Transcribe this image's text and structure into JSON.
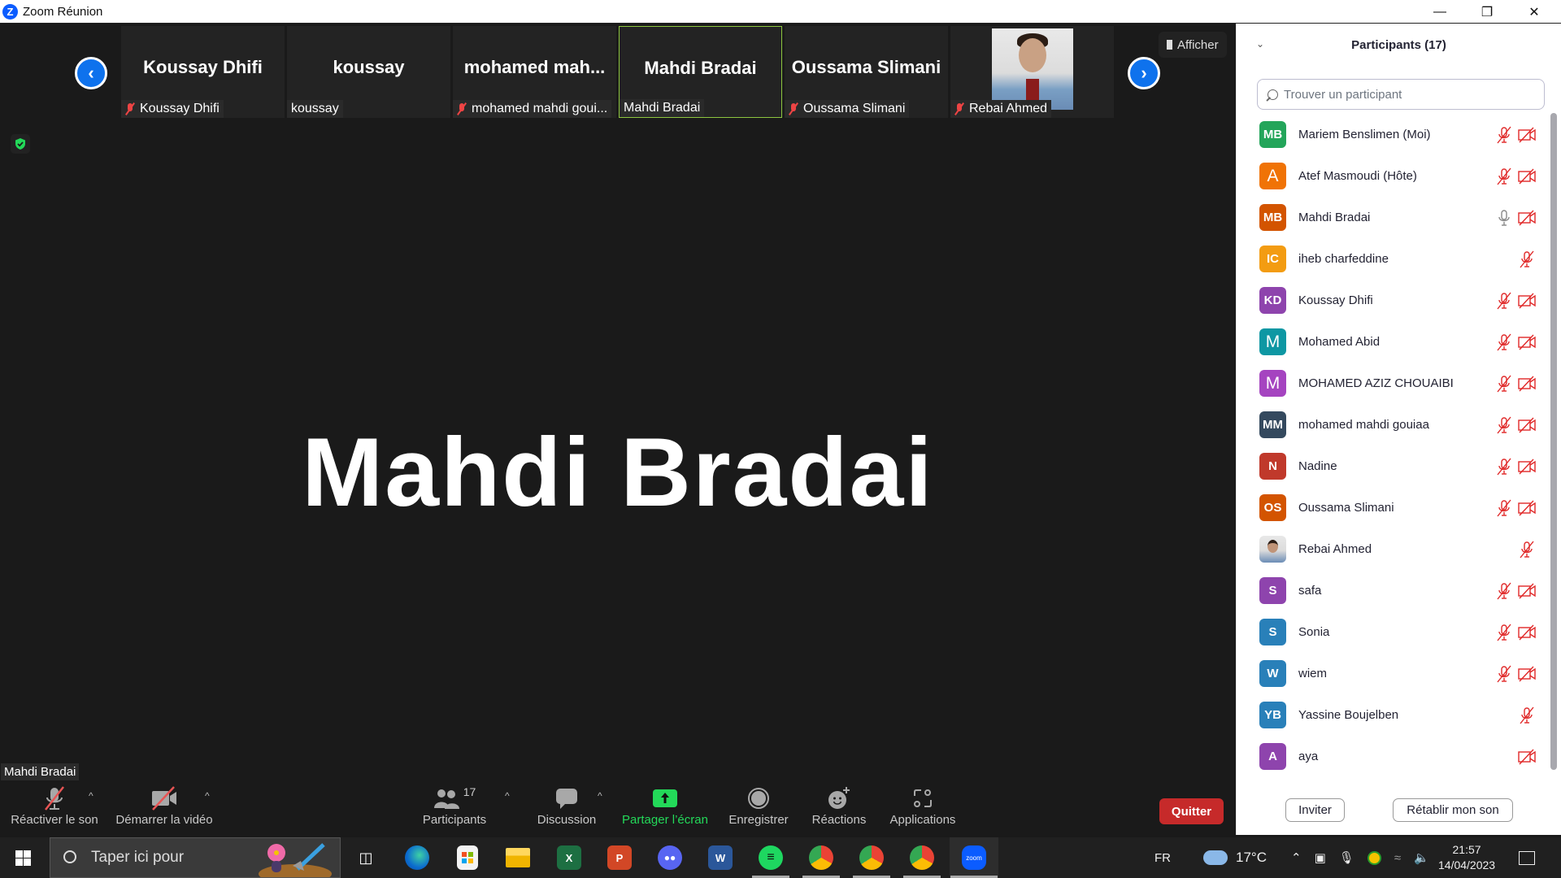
{
  "window": {
    "title": "Zoom Réunion",
    "controls": {
      "minimize": "—",
      "restore": "❐",
      "close": "✕"
    }
  },
  "strip": {
    "thumbnails": [
      {
        "display_name": "Koussay Dhifi",
        "label": "Koussay Dhifi",
        "muted": true,
        "active": false
      },
      {
        "display_name": "koussay",
        "label": "koussay",
        "muted": false,
        "active": false
      },
      {
        "display_name": "mohamed  mah...",
        "label": "mohamed mahdi goui...",
        "muted": true,
        "active": false
      },
      {
        "display_name": "Mahdi Bradai",
        "label": "Mahdi Bradai",
        "muted": false,
        "active": true
      },
      {
        "display_name": "Oussama Slimani",
        "label": "Oussama Slimani",
        "muted": true,
        "active": false
      },
      {
        "display_name": "",
        "label": "Rebai Ahmed",
        "muted": true,
        "active": false,
        "has_video": true
      }
    ],
    "prev_icon": "‹",
    "next_icon": "›"
  },
  "view": {
    "afficher_label": "Afficher",
    "active_speaker": "Mahdi Bradai",
    "speaker_tooltip": "Mahdi Bradai"
  },
  "toolbar": {
    "unmute_label": "Réactiver le son",
    "start_video_label": "Démarrer la vidéo",
    "participants_label": "Participants",
    "participants_count": "17",
    "chat_label": "Discussion",
    "share_label": "Partager l’écran",
    "record_label": "Enregistrer",
    "reactions_label": "Réactions",
    "apps_label": "Applications",
    "leave_label": "Quitter",
    "caret": "^"
  },
  "panel": {
    "title": "Participants (17)",
    "search_placeholder": "Trouver un participant",
    "participants": [
      {
        "initials": "MB",
        "name": "Mariem Benslimen (Moi)",
        "color": "#23a55a",
        "mic": "muted",
        "cam": "off"
      },
      {
        "initials": "A",
        "name": "Atef Masmoudi (Hôte)",
        "color": "#f07306",
        "mic": "muted",
        "cam": "off"
      },
      {
        "initials": "MB",
        "name": "Mahdi Bradai",
        "color": "#d35400",
        "mic": "on",
        "cam": "off"
      },
      {
        "initials": "IC",
        "name": "iheb charfeddine",
        "color": "#f39c12",
        "mic": "muted",
        "cam": "none"
      },
      {
        "initials": "KD",
        "name": "Koussay Dhifi",
        "color": "#8e44ad",
        "mic": "muted",
        "cam": "off"
      },
      {
        "initials": "M",
        "name": "Mohamed Abid",
        "color": "#0e97a3",
        "mic": "muted",
        "cam": "off"
      },
      {
        "initials": "M",
        "name": "MOHAMED AZIZ CHOUAIBI",
        "color": "#a544c0",
        "mic": "muted",
        "cam": "off"
      },
      {
        "initials": "MM",
        "name": "mohamed mahdi gouiaa",
        "color": "#34495e",
        "mic": "muted",
        "cam": "off"
      },
      {
        "initials": "N",
        "name": "Nadine",
        "color": "#c0392b",
        "mic": "muted",
        "cam": "off"
      },
      {
        "initials": "OS",
        "name": "Oussama Slimani",
        "color": "#d35400",
        "mic": "muted",
        "cam": "off"
      },
      {
        "initials": "",
        "name": "Rebai Ahmed",
        "color": "photo",
        "mic": "muted",
        "cam": "none"
      },
      {
        "initials": "S",
        "name": "safa",
        "color": "#8e44ad",
        "mic": "muted",
        "cam": "off"
      },
      {
        "initials": "S",
        "name": "Sonia",
        "color": "#2980b9",
        "mic": "muted",
        "cam": "off"
      },
      {
        "initials": "W",
        "name": "wiem",
        "color": "#2980b9",
        "mic": "muted",
        "cam": "off"
      },
      {
        "initials": "YB",
        "name": "Yassine Boujelben",
        "color": "#2980b9",
        "mic": "muted",
        "cam": "none"
      },
      {
        "initials": "A",
        "name": "aya",
        "color": "#8e44ad",
        "mic": "none",
        "cam": "off"
      }
    ],
    "invite_label": "Inviter",
    "reclaim_audio_label": "Rétablir mon son"
  },
  "taskbar": {
    "search_placeholder": "Taper ici pour",
    "apps": [
      "task-view",
      "edge",
      "store",
      "file-explorer",
      "excel",
      "powerpoint",
      "discord",
      "word",
      "spotify",
      "chrome",
      "chrome-m",
      "chrome-b",
      "zoom"
    ],
    "language": "FR",
    "weather": "17°C",
    "time": "21:57",
    "date": "14/04/2023"
  },
  "colors": {
    "accent_blue": "#0e72ed",
    "mute_red": "#e02828",
    "share_green": "#23d959",
    "leave_red": "#c62a2a",
    "active_border": "#8dc63f"
  }
}
